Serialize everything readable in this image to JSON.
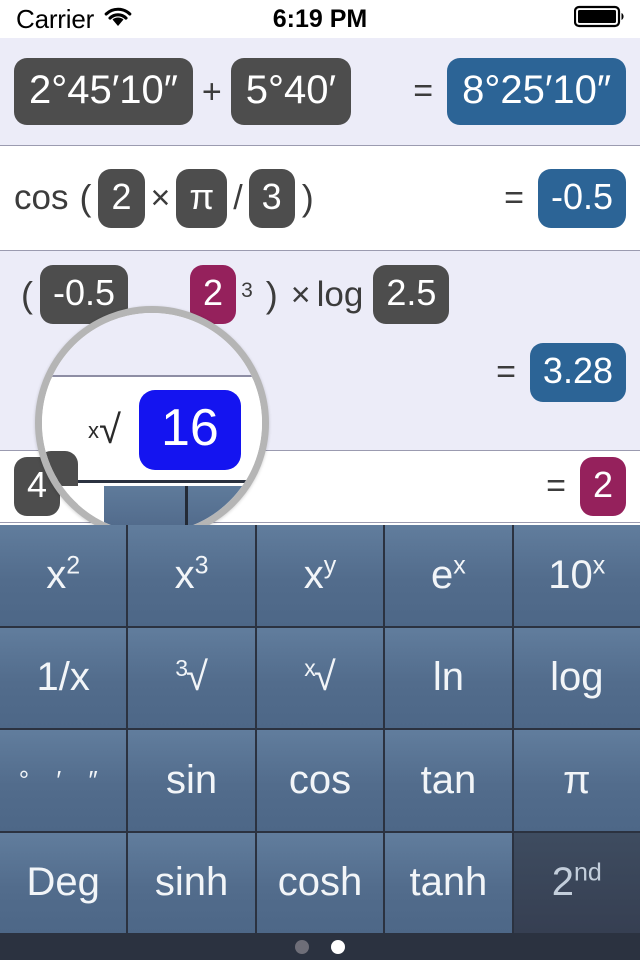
{
  "status_bar": {
    "carrier": "Carrier",
    "wifi_icon": "wifi-icon",
    "time": "6:19 PM",
    "battery_icon": "battery-full-icon"
  },
  "tape": {
    "rows": [
      {
        "id": "row-degrees-sum",
        "background": "#ececf8",
        "operand_a": "2°45′10″",
        "operator": "+",
        "operand_b": "5°40′",
        "equals": "=",
        "result": "8°25′10″",
        "result_color": "#2c6496"
      },
      {
        "id": "row-cosine",
        "background": "#ffffff",
        "function": "cos",
        "open_paren": "(",
        "operand_a": "2",
        "operator": "×",
        "operand_b": "π",
        "divider": "/",
        "operand_c": "3",
        "close_paren": ")",
        "equals": "=",
        "result": "-0.5",
        "result_color": "#2c6496"
      },
      {
        "id": "row-power-log",
        "background": "#ececf8",
        "open_paren": "(",
        "operand_a": "-0.5",
        "operand_b": "2",
        "operand_b_color": "#95215c",
        "exponent": "3",
        "close_paren": ")",
        "operator": "×",
        "function": "log",
        "operand_c": "2.5",
        "equals": "=",
        "result": "3.28",
        "result_color": "#2c6496"
      },
      {
        "id": "row-nth-root",
        "background": "#ffffff",
        "operand_a": "4",
        "root_glyph": "ˣ√",
        "operand_b": "16",
        "operand_b_color": "#1414f0",
        "equals": "=",
        "result": "2",
        "result_color": "#95215c"
      }
    ]
  },
  "loupe": {
    "name": "text-magnifier-loupe",
    "root_prefix": "x",
    "root_glyph": "√",
    "selected_value": "16",
    "selected_color": "#1414f0",
    "border_color": "#b5b5b5"
  },
  "keypad": {
    "keys": [
      {
        "id": "key-x-squared",
        "base": "x",
        "sup": "2",
        "pre": "",
        "style": "normal"
      },
      {
        "id": "key-x-cubed",
        "base": "x",
        "sup": "3",
        "pre": "",
        "style": "normal"
      },
      {
        "id": "key-x-to-y",
        "base": "x",
        "sup": "y",
        "pre": "",
        "style": "normal"
      },
      {
        "id": "key-e-to-x",
        "base": "e",
        "sup": "x",
        "pre": "",
        "style": "normal"
      },
      {
        "id": "key-10-to-x",
        "base": "10",
        "sup": "x",
        "pre": "",
        "style": "normal"
      },
      {
        "id": "key-reciprocal",
        "base": "1/x",
        "sup": "",
        "pre": "",
        "style": "normal"
      },
      {
        "id": "key-cube-root",
        "base": "√",
        "sup": "",
        "pre": "3",
        "style": "normal"
      },
      {
        "id": "key-nth-root",
        "base": "√",
        "sup": "",
        "pre": "x",
        "style": "normal"
      },
      {
        "id": "key-ln",
        "base": "ln",
        "sup": "",
        "pre": "",
        "style": "normal"
      },
      {
        "id": "key-log",
        "base": "log",
        "sup": "",
        "pre": "",
        "style": "normal"
      },
      {
        "id": "key-dms",
        "base": "° ′ ″",
        "sup": "",
        "pre": "",
        "style": "dms"
      },
      {
        "id": "key-sin",
        "base": "sin",
        "sup": "",
        "pre": "",
        "style": "normal"
      },
      {
        "id": "key-cos",
        "base": "cos",
        "sup": "",
        "pre": "",
        "style": "normal"
      },
      {
        "id": "key-tan",
        "base": "tan",
        "sup": "",
        "pre": "",
        "style": "normal"
      },
      {
        "id": "key-pi",
        "base": "π",
        "sup": "",
        "pre": "",
        "style": "normal"
      },
      {
        "id": "key-deg",
        "base": "Deg",
        "sup": "",
        "pre": "",
        "style": "normal"
      },
      {
        "id": "key-sinh",
        "base": "sinh",
        "sup": "",
        "pre": "",
        "style": "normal"
      },
      {
        "id": "key-cosh",
        "base": "cosh",
        "sup": "",
        "pre": "",
        "style": "normal"
      },
      {
        "id": "key-tanh",
        "base": "tanh",
        "sup": "",
        "pre": "",
        "style": "normal"
      },
      {
        "id": "key-second",
        "base": "2",
        "sup": "nd",
        "pre": "",
        "style": "dark"
      }
    ]
  },
  "page_dots": {
    "count": 2,
    "active_index": 1
  }
}
